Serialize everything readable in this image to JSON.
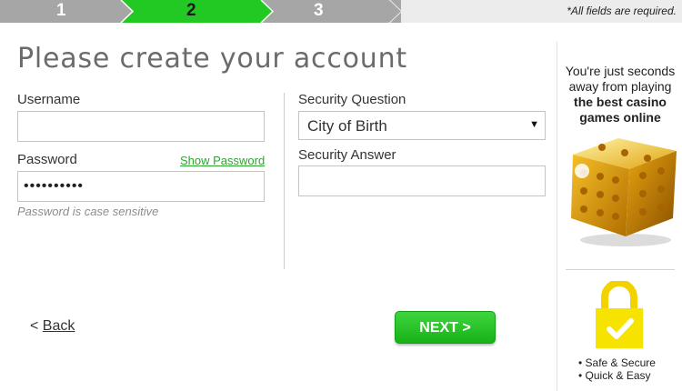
{
  "progress": {
    "steps": [
      "1",
      "2",
      "3"
    ],
    "active_step": 2,
    "required_note": "*All fields are required.",
    "colors": {
      "inactive": "#a6a6a6",
      "active": "#22c922"
    }
  },
  "title": "Please create your account",
  "form": {
    "username": {
      "label": "Username",
      "value": ""
    },
    "password": {
      "label": "Password",
      "show_link": "Show Password",
      "masked_value": "••••••••••",
      "hint": "Password is case sensitive"
    },
    "security_question": {
      "label": "Security Question",
      "selected": "City of Birth"
    },
    "security_answer": {
      "label": "Security Answer",
      "value": ""
    }
  },
  "nav": {
    "back_prefix": "< ",
    "back_label": "Back",
    "next_label": "NEXT >"
  },
  "sidebar": {
    "promo_line1": "You're just seconds",
    "promo_line2": "away from playing",
    "promo_bold1": "the best casino",
    "promo_bold2": "games online",
    "features": [
      "• Safe & Secure",
      "• Quick & Easy"
    ],
    "icons": [
      "gold-dice-icon",
      "padlock-check-icon"
    ]
  }
}
